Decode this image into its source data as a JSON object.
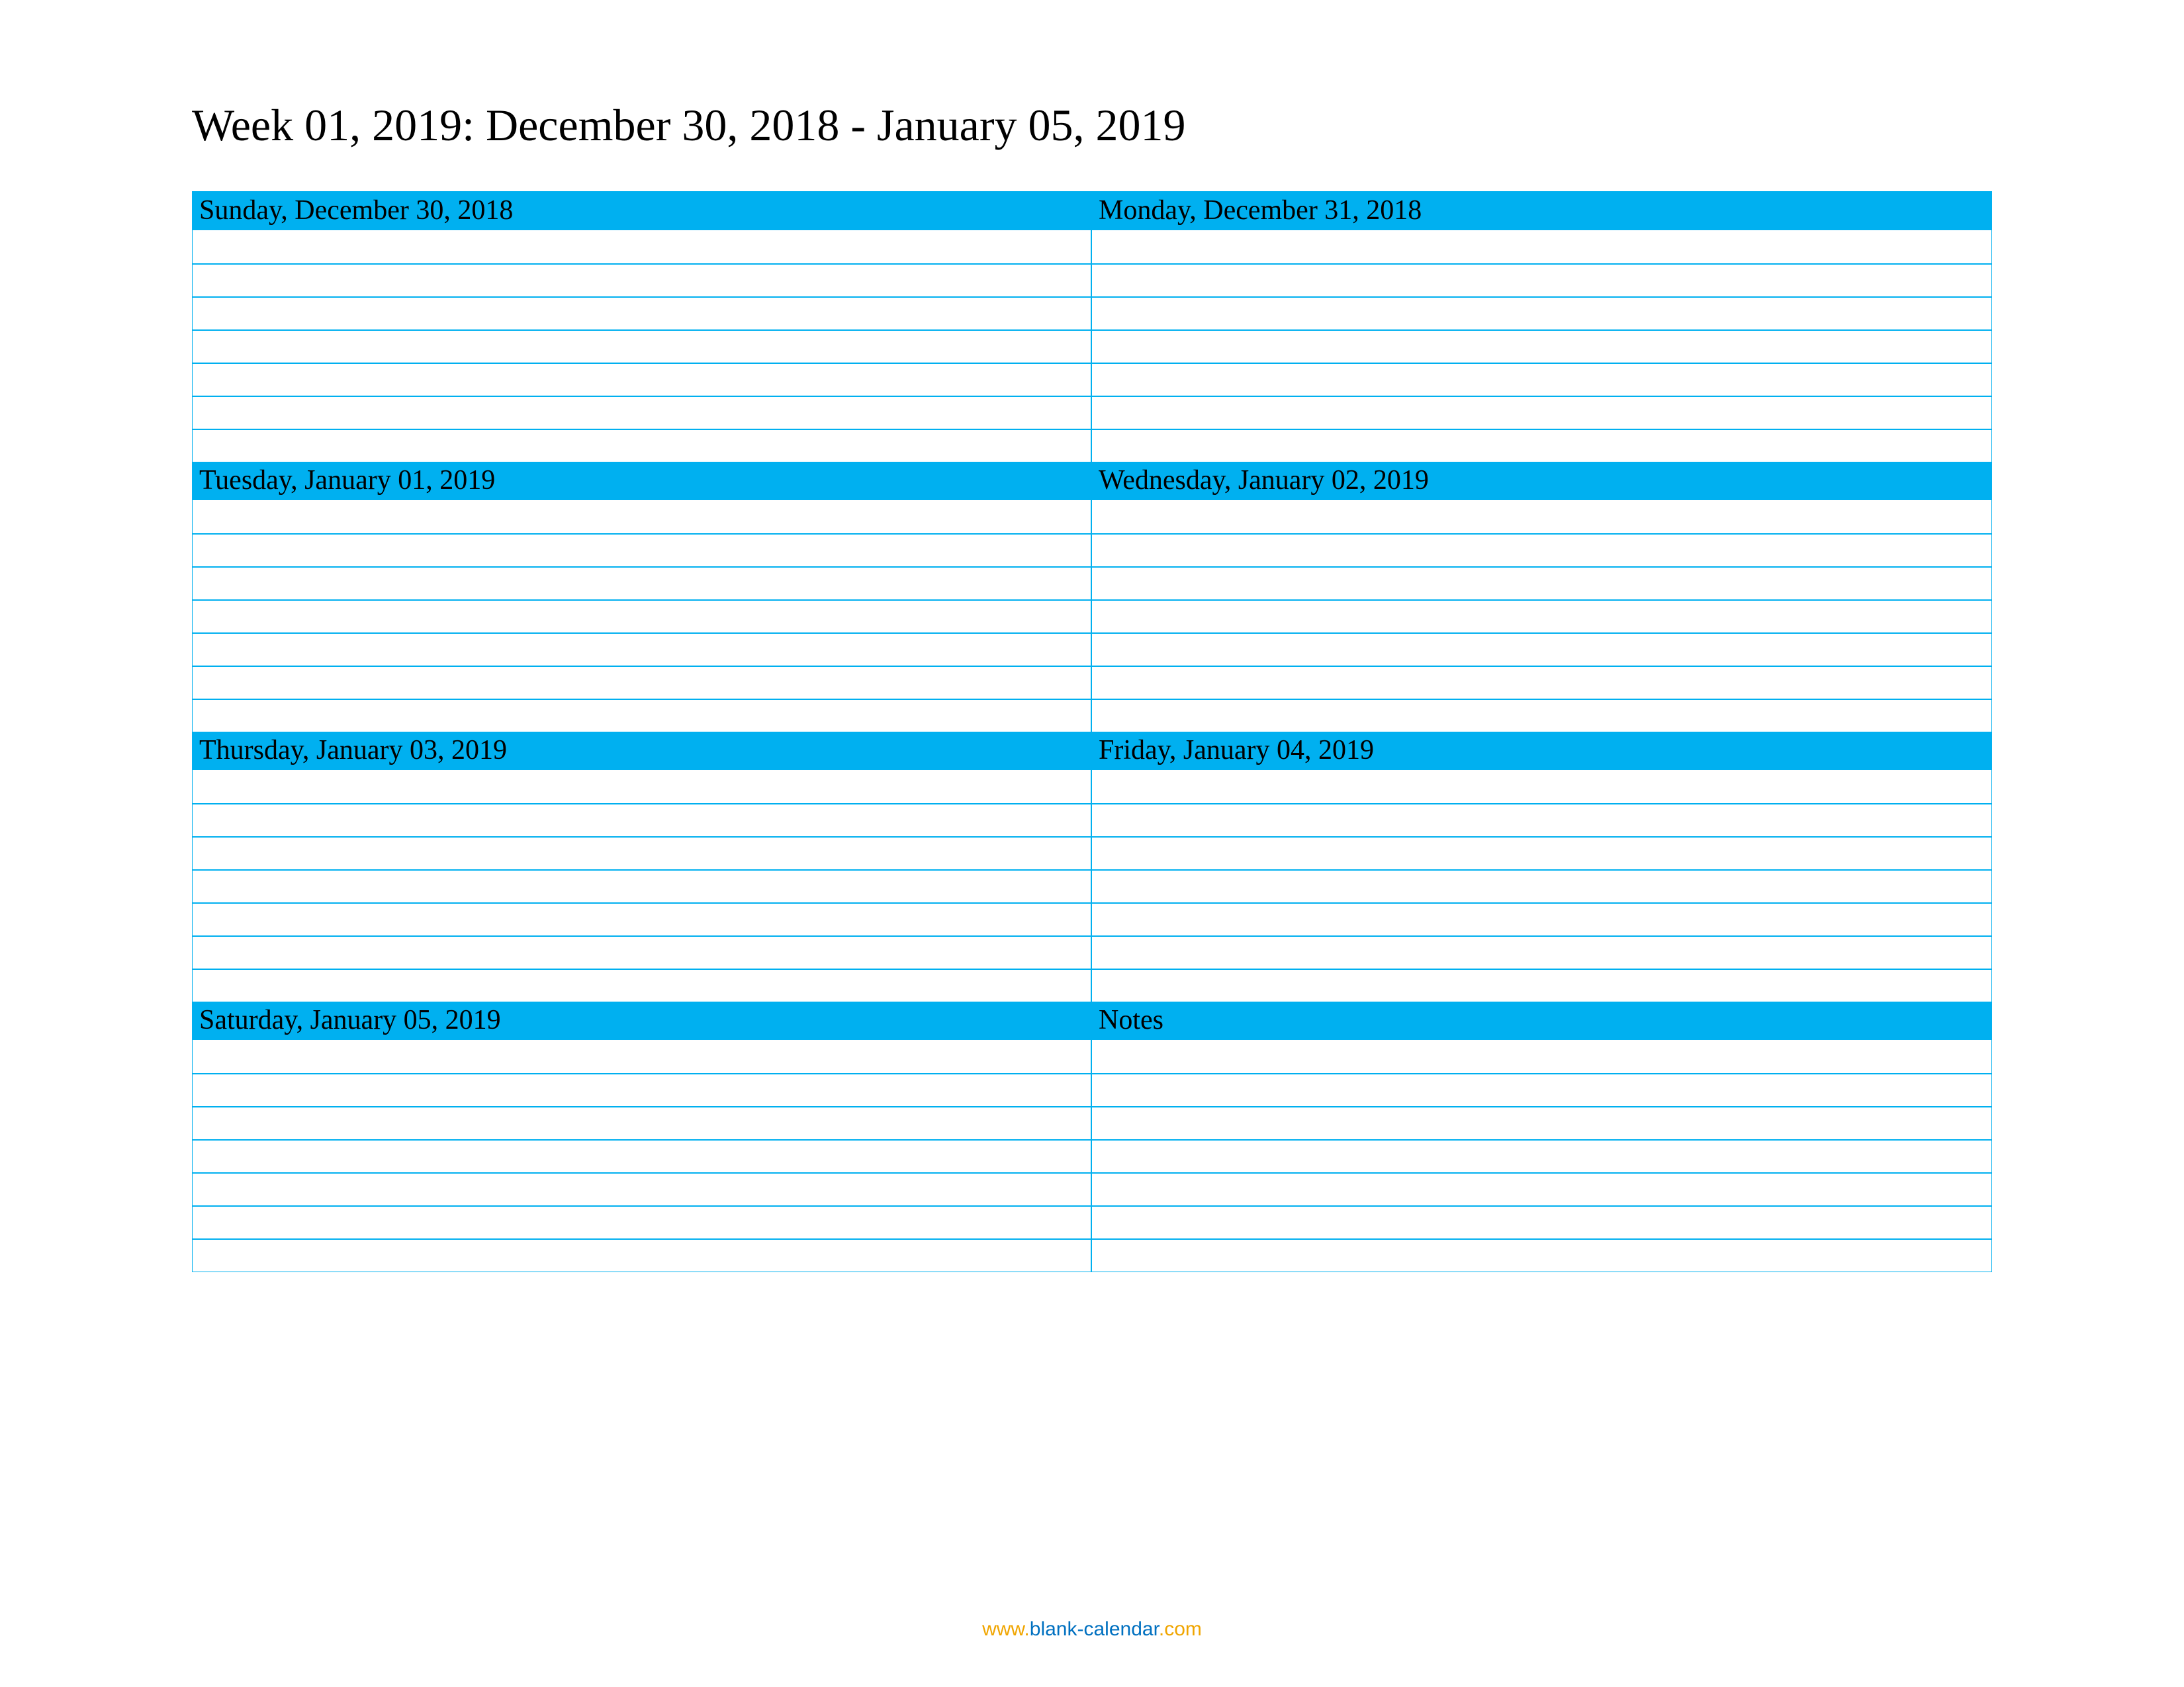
{
  "title": "Week 01, 2019: December 30, 2018 - January 05, 2019",
  "rows_per_day": 7,
  "blocks": [
    {
      "label": "Sunday, December 30, 2018"
    },
    {
      "label": "Monday, December 31, 2018"
    },
    {
      "label": "Tuesday, January 01, 2019"
    },
    {
      "label": "Wednesday, January 02, 2019"
    },
    {
      "label": "Thursday, January 03, 2019"
    },
    {
      "label": "Friday, January 04, 2019"
    },
    {
      "label": "Saturday, January 05, 2019"
    },
    {
      "label": "Notes"
    }
  ],
  "footer": {
    "www": "www.",
    "domain": "blank-calendar",
    "com": ".com"
  }
}
